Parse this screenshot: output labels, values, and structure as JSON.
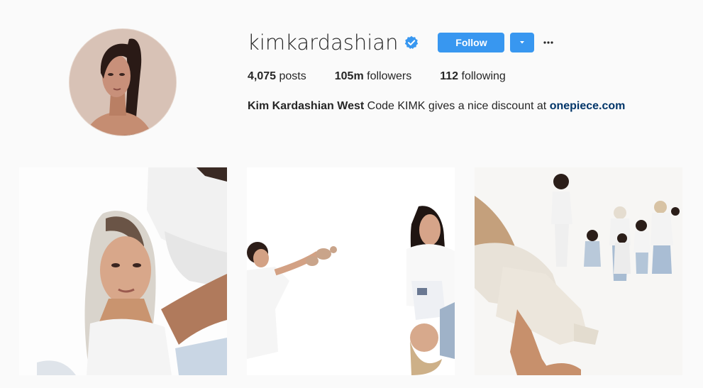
{
  "profile": {
    "username": "kimkardashian",
    "verified": true,
    "follow_label": "Follow",
    "stats": {
      "posts_count": "4,075",
      "posts_label": "posts",
      "followers_count": "105m",
      "followers_label": "followers",
      "following_count": "112",
      "following_label": "following"
    },
    "bio": {
      "full_name": "Kim Kardashian West",
      "text": "Code KIMK gives a nice discount at",
      "link": "onepiece.com"
    }
  },
  "colors": {
    "accent": "#3897f0",
    "link": "#003569",
    "background": "#fafafa"
  },
  "icons": {
    "verified": "verified-badge-icon",
    "dropdown": "caret-down-icon",
    "more": "more-options-icon"
  }
}
